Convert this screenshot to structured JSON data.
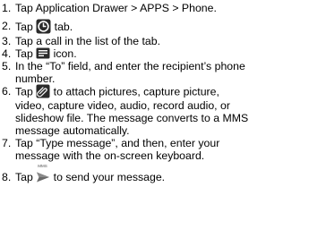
{
  "steps": [
    {
      "num": "1.",
      "lines": [
        "Tap Application Drawer > APPS > Phone."
      ]
    },
    {
      "num": "2.",
      "pre": "Tap",
      "post": "tab.",
      "icon": "clock-icon"
    },
    {
      "num": "3.",
      "lines": [
        "Tap a call in the list of the tab."
      ]
    },
    {
      "num": "4.",
      "pre": "Tap",
      "post": "icon.",
      "icon": "message-icon"
    },
    {
      "num": "5.",
      "lines": [
        "In the “To” field, and enter the recipient’s phone",
        "number."
      ]
    },
    {
      "num": "6.",
      "pre": "Tap",
      "post": "to attach pictures, capture picture,",
      "icon": "attach-icon",
      "lines": [
        "video, capture video, audio, record audio, or",
        "slideshow file. The message converts to a MMS",
        "message automatically."
      ]
    },
    {
      "num": "7.",
      "lines": [
        "Tap “Type message”, and then, enter your",
        "message with the on-screen keyboard."
      ]
    },
    {
      "num": "8.",
      "pre": "Tap",
      "post": "to send your message.",
      "icon": "send-icon",
      "icon_label": "MMS"
    }
  ],
  "colors": {
    "text": "#000000",
    "icon_dark": "#2b2b2b",
    "icon_mid": "#555555"
  }
}
